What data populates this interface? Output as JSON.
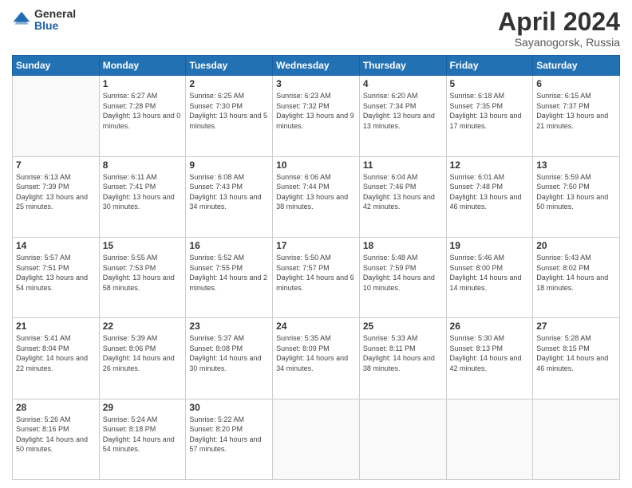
{
  "header": {
    "logo_general": "General",
    "logo_blue": "Blue",
    "title": "April 2024",
    "subtitle": "Sayanogorsk, Russia"
  },
  "columns": [
    "Sunday",
    "Monday",
    "Tuesday",
    "Wednesday",
    "Thursday",
    "Friday",
    "Saturday"
  ],
  "weeks": [
    [
      {
        "day": "",
        "sunrise": "",
        "sunset": "",
        "daylight": "",
        "empty": true
      },
      {
        "day": "1",
        "sunrise": "Sunrise: 6:27 AM",
        "sunset": "Sunset: 7:28 PM",
        "daylight": "Daylight: 13 hours and 0 minutes."
      },
      {
        "day": "2",
        "sunrise": "Sunrise: 6:25 AM",
        "sunset": "Sunset: 7:30 PM",
        "daylight": "Daylight: 13 hours and 5 minutes."
      },
      {
        "day": "3",
        "sunrise": "Sunrise: 6:23 AM",
        "sunset": "Sunset: 7:32 PM",
        "daylight": "Daylight: 13 hours and 9 minutes."
      },
      {
        "day": "4",
        "sunrise": "Sunrise: 6:20 AM",
        "sunset": "Sunset: 7:34 PM",
        "daylight": "Daylight: 13 hours and 13 minutes."
      },
      {
        "day": "5",
        "sunrise": "Sunrise: 6:18 AM",
        "sunset": "Sunset: 7:35 PM",
        "daylight": "Daylight: 13 hours and 17 minutes."
      },
      {
        "day": "6",
        "sunrise": "Sunrise: 6:15 AM",
        "sunset": "Sunset: 7:37 PM",
        "daylight": "Daylight: 13 hours and 21 minutes."
      }
    ],
    [
      {
        "day": "7",
        "sunrise": "Sunrise: 6:13 AM",
        "sunset": "Sunset: 7:39 PM",
        "daylight": "Daylight: 13 hours and 25 minutes."
      },
      {
        "day": "8",
        "sunrise": "Sunrise: 6:11 AM",
        "sunset": "Sunset: 7:41 PM",
        "daylight": "Daylight: 13 hours and 30 minutes."
      },
      {
        "day": "9",
        "sunrise": "Sunrise: 6:08 AM",
        "sunset": "Sunset: 7:43 PM",
        "daylight": "Daylight: 13 hours and 34 minutes."
      },
      {
        "day": "10",
        "sunrise": "Sunrise: 6:06 AM",
        "sunset": "Sunset: 7:44 PM",
        "daylight": "Daylight: 13 hours and 38 minutes."
      },
      {
        "day": "11",
        "sunrise": "Sunrise: 6:04 AM",
        "sunset": "Sunset: 7:46 PM",
        "daylight": "Daylight: 13 hours and 42 minutes."
      },
      {
        "day": "12",
        "sunrise": "Sunrise: 6:01 AM",
        "sunset": "Sunset: 7:48 PM",
        "daylight": "Daylight: 13 hours and 46 minutes."
      },
      {
        "day": "13",
        "sunrise": "Sunrise: 5:59 AM",
        "sunset": "Sunset: 7:50 PM",
        "daylight": "Daylight: 13 hours and 50 minutes."
      }
    ],
    [
      {
        "day": "14",
        "sunrise": "Sunrise: 5:57 AM",
        "sunset": "Sunset: 7:51 PM",
        "daylight": "Daylight: 13 hours and 54 minutes."
      },
      {
        "day": "15",
        "sunrise": "Sunrise: 5:55 AM",
        "sunset": "Sunset: 7:53 PM",
        "daylight": "Daylight: 13 hours and 58 minutes."
      },
      {
        "day": "16",
        "sunrise": "Sunrise: 5:52 AM",
        "sunset": "Sunset: 7:55 PM",
        "daylight": "Daylight: 14 hours and 2 minutes."
      },
      {
        "day": "17",
        "sunrise": "Sunrise: 5:50 AM",
        "sunset": "Sunset: 7:57 PM",
        "daylight": "Daylight: 14 hours and 6 minutes."
      },
      {
        "day": "18",
        "sunrise": "Sunrise: 5:48 AM",
        "sunset": "Sunset: 7:59 PM",
        "daylight": "Daylight: 14 hours and 10 minutes."
      },
      {
        "day": "19",
        "sunrise": "Sunrise: 5:46 AM",
        "sunset": "Sunset: 8:00 PM",
        "daylight": "Daylight: 14 hours and 14 minutes."
      },
      {
        "day": "20",
        "sunrise": "Sunrise: 5:43 AM",
        "sunset": "Sunset: 8:02 PM",
        "daylight": "Daylight: 14 hours and 18 minutes."
      }
    ],
    [
      {
        "day": "21",
        "sunrise": "Sunrise: 5:41 AM",
        "sunset": "Sunset: 8:04 PM",
        "daylight": "Daylight: 14 hours and 22 minutes."
      },
      {
        "day": "22",
        "sunrise": "Sunrise: 5:39 AM",
        "sunset": "Sunset: 8:06 PM",
        "daylight": "Daylight: 14 hours and 26 minutes."
      },
      {
        "day": "23",
        "sunrise": "Sunrise: 5:37 AM",
        "sunset": "Sunset: 8:08 PM",
        "daylight": "Daylight: 14 hours and 30 minutes."
      },
      {
        "day": "24",
        "sunrise": "Sunrise: 5:35 AM",
        "sunset": "Sunset: 8:09 PM",
        "daylight": "Daylight: 14 hours and 34 minutes."
      },
      {
        "day": "25",
        "sunrise": "Sunrise: 5:33 AM",
        "sunset": "Sunset: 8:11 PM",
        "daylight": "Daylight: 14 hours and 38 minutes."
      },
      {
        "day": "26",
        "sunrise": "Sunrise: 5:30 AM",
        "sunset": "Sunset: 8:13 PM",
        "daylight": "Daylight: 14 hours and 42 minutes."
      },
      {
        "day": "27",
        "sunrise": "Sunrise: 5:28 AM",
        "sunset": "Sunset: 8:15 PM",
        "daylight": "Daylight: 14 hours and 46 minutes."
      }
    ],
    [
      {
        "day": "28",
        "sunrise": "Sunrise: 5:26 AM",
        "sunset": "Sunset: 8:16 PM",
        "daylight": "Daylight: 14 hours and 50 minutes."
      },
      {
        "day": "29",
        "sunrise": "Sunrise: 5:24 AM",
        "sunset": "Sunset: 8:18 PM",
        "daylight": "Daylight: 14 hours and 54 minutes."
      },
      {
        "day": "30",
        "sunrise": "Sunrise: 5:22 AM",
        "sunset": "Sunset: 8:20 PM",
        "daylight": "Daylight: 14 hours and 57 minutes."
      },
      {
        "day": "",
        "sunrise": "",
        "sunset": "",
        "daylight": "",
        "empty": true
      },
      {
        "day": "",
        "sunrise": "",
        "sunset": "",
        "daylight": "",
        "empty": true
      },
      {
        "day": "",
        "sunrise": "",
        "sunset": "",
        "daylight": "",
        "empty": true
      },
      {
        "day": "",
        "sunrise": "",
        "sunset": "",
        "daylight": "",
        "empty": true
      }
    ]
  ]
}
